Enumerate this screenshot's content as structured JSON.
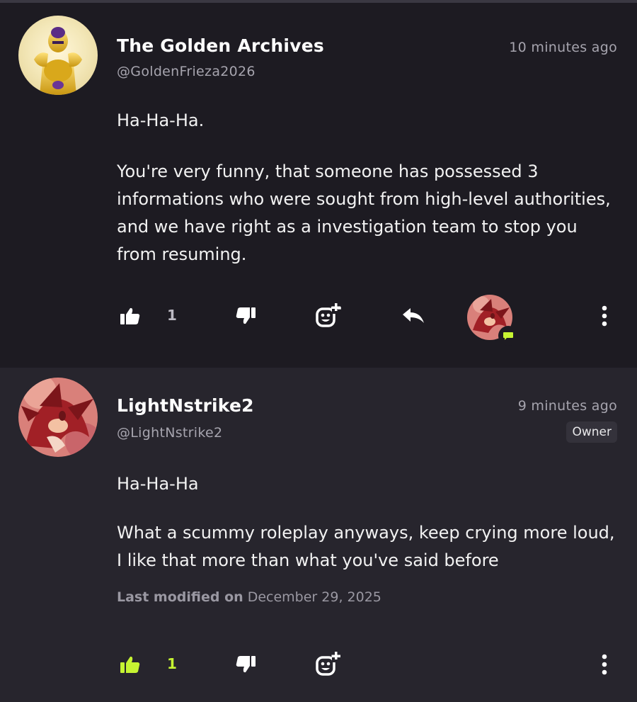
{
  "posts": [
    {
      "author_name": "The Golden Archives",
      "handle": "@GoldenFrieza2026",
      "time": "10 minutes ago",
      "paragraph_1": "Ha-Ha-Ha.",
      "paragraph_2": "You're very funny, that someone has possessed 3 informations who were sought from high-level authorities, and we have right as a investigation team to stop you from resuming.",
      "like_count": "1",
      "liked": false
    },
    {
      "author_name": "LightNstrike2",
      "handle": "@LightNstrike2",
      "time": "9 minutes ago",
      "badge": "Owner",
      "paragraph_1": "Ha-Ha-Ha",
      "paragraph_2": "What a scummy roleplay anyways, keep crying more loud, I like that more than what you've said before",
      "modified_label": "Last modified on",
      "modified_date": "December 29, 2025",
      "like_count": "1",
      "liked": true
    }
  ],
  "icons": {
    "like": "thumbs-up-icon",
    "dislike": "thumbs-down-icon",
    "react": "add-reaction-icon",
    "reply": "reply-icon",
    "more": "more-vertical-icon",
    "reply_thread": "chat-bubble-icon"
  },
  "colors": {
    "accent": "#c6f432",
    "background": "#1d1b22",
    "background_alt": "#27252d",
    "muted_text": "#a6a4ae"
  }
}
